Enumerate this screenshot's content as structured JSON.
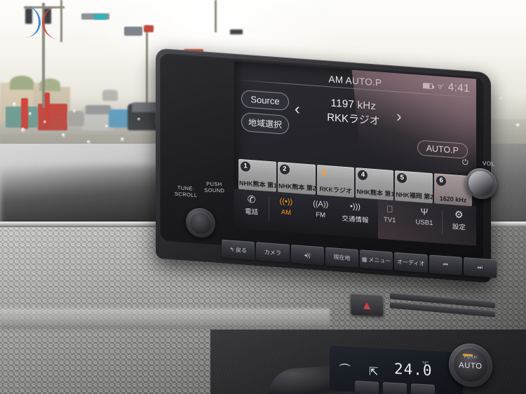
{
  "screen": {
    "status_bar": {
      "title": "AM AUTO.P",
      "clock": "4:41",
      "battery_icon": "battery-icon",
      "signal_icon": "signal-off-icon"
    },
    "left_buttons": [
      {
        "label": "Source",
        "name": "source-button"
      },
      {
        "label": "地域選択",
        "name": "region-select-button"
      }
    ],
    "prev_chevron": "‹",
    "next_chevron": "›",
    "now_playing": {
      "frequency": "1197 kHz",
      "station": "RKKラジオ"
    },
    "auto_preset_button": "AUTO.P",
    "presets": [
      {
        "number": "1",
        "label": "NHK熊本 第1",
        "active": false
      },
      {
        "number": "2",
        "label": "NHK熊本 第2",
        "active": false
      },
      {
        "number": "3",
        "label": "RKKラジオ",
        "active": true
      },
      {
        "number": "4",
        "label": "NHK熊本 第1",
        "active": false
      },
      {
        "number": "5",
        "label": "NHK福岡 第2",
        "active": false
      },
      {
        "number": "6",
        "label": "1620 kHz",
        "active": false
      }
    ],
    "function_bar": [
      {
        "label": "電話",
        "icon": "phone-icon",
        "glyph": "✆",
        "active": false
      },
      {
        "label": "AM",
        "icon": "am-radio-icon",
        "glyph": "((•))",
        "active": true
      },
      {
        "label": "FM",
        "icon": "fm-radio-icon",
        "glyph": "((A))",
        "active": false
      },
      {
        "label": "交通情報",
        "icon": "traffic-info-icon",
        "glyph": "•))",
        "active": false
      },
      {
        "label": "TV1",
        "icon": "tv-icon",
        "glyph": "▭",
        "active": false
      },
      {
        "label": "USB1",
        "icon": "usb-icon",
        "glyph": "⚿",
        "active": false
      },
      {
        "label": "設定",
        "icon": "gear-icon",
        "glyph": "✾",
        "active": false
      }
    ]
  },
  "hardware": {
    "left_knob": {
      "name": "tune-scroll-knob",
      "label_top": "TUNE·",
      "label_bottom": "SCROLL",
      "push_label_top": "PUSH",
      "push_label_bottom": "SOUND"
    },
    "right_knob": {
      "name": "volume-knob",
      "power_icon": "⏻",
      "label": "VOL"
    },
    "buttons": [
      {
        "label": "戻る",
        "icon": "back-arrow-icon",
        "glyph": "↰"
      },
      {
        "label": "カメラ",
        "icon": "camera-icon",
        "glyph": ""
      },
      {
        "label": "",
        "icon": "mute-volume-icon",
        "glyph": "◂))"
      },
      {
        "label": "現在地",
        "icon": "current-location-icon",
        "glyph": ""
      },
      {
        "label": "メニュー",
        "icon": "menu-icon",
        "glyph": "▦"
      },
      {
        "label": "オーディオ",
        "icon": "audio-icon",
        "glyph": ""
      },
      {
        "label": "",
        "icon": "prev-track-icon",
        "glyph": "⏮"
      },
      {
        "label": "",
        "icon": "next-track-icon",
        "glyph": "⏭"
      }
    ]
  },
  "climate": {
    "temperature": "24.0",
    "degree_unit": "°C",
    "airflow_icon": "airflow-feet-icon",
    "defrost_icon": "defrost-icon",
    "auto_knob_label": "AUTO",
    "auto_knob_push": "PUSH"
  },
  "hazard_button": {
    "icon": "hazard-triangle-icon",
    "glyph": "▲"
  },
  "colors": {
    "accent_orange": "#ff9a1f",
    "hazard_red": "#c8414a",
    "screen_bg": "#25252b",
    "preset_face": "#9e9e9e"
  }
}
